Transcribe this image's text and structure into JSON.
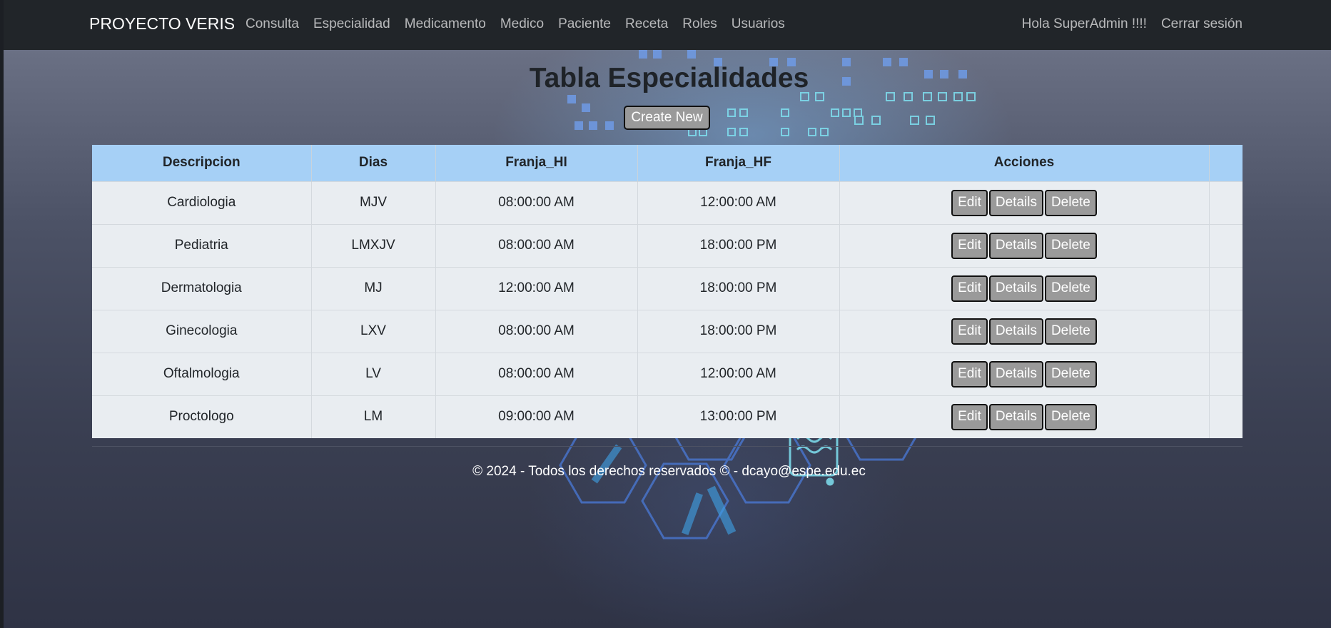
{
  "nav": {
    "brand": "PROYECTO VERIS",
    "links": [
      "Consulta",
      "Especialidad",
      "Medicamento",
      "Medico",
      "Paciente",
      "Receta",
      "Roles",
      "Usuarios"
    ],
    "greeting": "Hola SuperAdmin !!!!",
    "logout": "Cerrar sesión"
  },
  "main": {
    "title": "Tabla Especialidades",
    "create_label": "Create New"
  },
  "table": {
    "headers": [
      "Descripcion",
      "Dias",
      "Franja_HI",
      "Franja_HF",
      "Acciones"
    ],
    "actions": [
      "Edit",
      "Details",
      "Delete"
    ],
    "rows": [
      [
        "Cardiologia",
        "MJV",
        "08:00:00 AM",
        "12:00:00 AM"
      ],
      [
        "Pediatria",
        "LMXJV",
        "08:00:00 AM",
        "18:00:00 PM"
      ],
      [
        "Dermatologia",
        "MJ",
        "12:00:00 AM",
        "18:00:00 PM"
      ],
      [
        "Ginecologia",
        "LXV",
        "08:00:00 AM",
        "18:00:00 PM"
      ],
      [
        "Oftalmologia",
        "LV",
        "08:00:00 AM",
        "12:00:00 AM"
      ],
      [
        "Proctologo",
        "LM",
        "09:00:00 AM",
        "13:00:00 PM"
      ]
    ]
  },
  "footer": {
    "text": "© 2024 - Todos los derechos reservados © - dcayo@espe.edu.ec"
  },
  "colors": {
    "navbar": "#212529",
    "table_header": "#a6d0f6",
    "table_body": "#e9edf1",
    "button": "#9a9a9a"
  }
}
